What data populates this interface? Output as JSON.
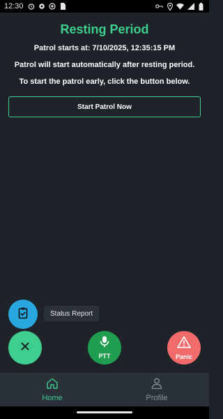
{
  "status_bar": {
    "time": "12:30",
    "icons_left": [
      "alarm-icon",
      "settings-icon",
      "notification-icon",
      "sim-icon"
    ],
    "icons_right": [
      "vpn-key-icon",
      "location-icon",
      "wifi-icon",
      "signal-icon",
      "battery-icon"
    ]
  },
  "main": {
    "title": "Resting Period",
    "patrol_start": "Patrol starts at: 7/10/2025, 12:35:15 PM",
    "auto_start_note": "Patrol will start automatically after resting period.",
    "early_start_note": "To start the patrol early, click the button below.",
    "start_button_label": "Start Patrol Now"
  },
  "fabs": {
    "status_report_tooltip": "Status Report",
    "ptt_label": "PTT",
    "panic_label": "Panic"
  },
  "bottom_nav": {
    "items": [
      {
        "label": "Home",
        "icon": "home-icon",
        "active": true
      },
      {
        "label": "Profile",
        "icon": "person-icon",
        "active": false
      }
    ]
  },
  "colors": {
    "background": "#1e232a",
    "accent_green": "#3ecf8e",
    "status_blue": "#29a8e0",
    "ptt_green": "#1f9e4f",
    "panic_red": "#f26b6b",
    "nav_background": "#2b3139"
  }
}
